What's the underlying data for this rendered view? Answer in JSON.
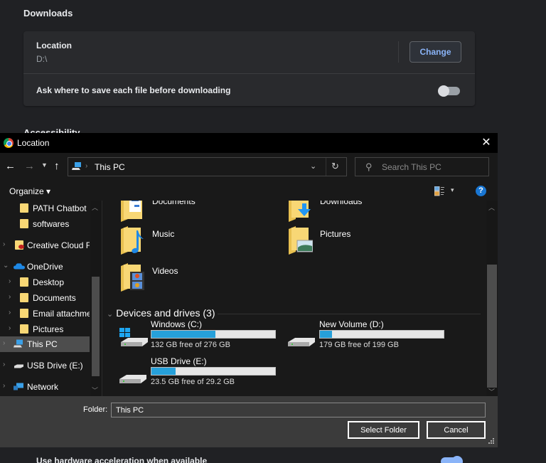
{
  "settings": {
    "downloads_heading": "Downloads",
    "location_label": "Location",
    "location_value": "D:\\",
    "change_button": "Change",
    "ask_label": "Ask where to save each file before downloading",
    "ask_toggle_on": false,
    "accessibility_heading": "Accessibility",
    "hw_accel_label": "Use hardware acceleration when available",
    "hw_accel_on": true,
    "accent_color": "#8ab4f8"
  },
  "dialog": {
    "title": "Location",
    "close_icon": "close-icon",
    "nav": {
      "back_icon": "←",
      "forward_icon": "→",
      "recent_icon": "⌄",
      "up_icon": "↑",
      "address_separator": "›",
      "address_path": "This PC",
      "dropdown_icon": "⌄",
      "refresh_icon": "↻",
      "search_placeholder": "Search This PC"
    },
    "toolbar": {
      "organize_label": "Organize ▾",
      "view_dropdown": "▾",
      "help_label": "?"
    },
    "sidebar": {
      "items": [
        {
          "label": "PATH Chatbot",
          "icon": "folder-icon",
          "indent": 2,
          "expandable": false,
          "selected": false
        },
        {
          "label": "softwares",
          "icon": "folder-icon",
          "indent": 2,
          "expandable": false,
          "selected": false
        },
        {
          "label": "Creative Cloud Fil",
          "icon": "creative-cloud-folder-icon",
          "indent": 1,
          "expandable": true,
          "selected": false
        },
        {
          "label": "OneDrive",
          "icon": "onedrive-icon",
          "indent": 1,
          "expandable": true,
          "expanded": true,
          "selected": false
        },
        {
          "label": "Desktop",
          "icon": "folder-icon",
          "indent": 2,
          "expandable": true,
          "selected": false
        },
        {
          "label": "Documents",
          "icon": "folder-icon",
          "indent": 2,
          "expandable": true,
          "selected": false
        },
        {
          "label": "Email attachmer",
          "icon": "folder-icon",
          "indent": 2,
          "expandable": true,
          "selected": false
        },
        {
          "label": "Pictures",
          "icon": "folder-icon",
          "indent": 2,
          "expandable": true,
          "selected": false
        },
        {
          "label": "This PC",
          "icon": "this-pc-icon",
          "indent": 1,
          "expandable": true,
          "selected": true
        },
        {
          "label": "USB Drive (E:)",
          "icon": "usb-drive-icon",
          "indent": 1,
          "expandable": true,
          "selected": false
        },
        {
          "label": "Network",
          "icon": "network-icon",
          "indent": 1,
          "expandable": true,
          "selected": false
        }
      ]
    },
    "folders": [
      {
        "label": "Documents",
        "icon": "documents-folder-icon"
      },
      {
        "label": "Downloads",
        "icon": "downloads-folder-icon"
      },
      {
        "label": "Music",
        "icon": "music-folder-icon"
      },
      {
        "label": "Pictures",
        "icon": "pictures-folder-icon"
      },
      {
        "label": "Videos",
        "icon": "videos-folder-icon"
      }
    ],
    "devices_header": "Devices and drives (3)",
    "drives": [
      {
        "name": "Windows (C:)",
        "free": "132 GB free of 276 GB",
        "used_fraction": 0.52,
        "icon": "windows-drive-icon"
      },
      {
        "name": "New Volume (D:)",
        "free": "179 GB free of 199 GB",
        "used_fraction": 0.1,
        "icon": "hard-drive-icon"
      },
      {
        "name": "USB Drive (E:)",
        "free": "23.5 GB free of 29.2 GB",
        "used_fraction": 0.195,
        "icon": "usb-drive-icon"
      }
    ],
    "footer": {
      "folder_label": "Folder:",
      "folder_value": "This PC",
      "select_button": "Select Folder",
      "cancel_button": "Cancel"
    },
    "drive_bar_color": "#26a0da",
    "folder_color": "#f8d775"
  }
}
